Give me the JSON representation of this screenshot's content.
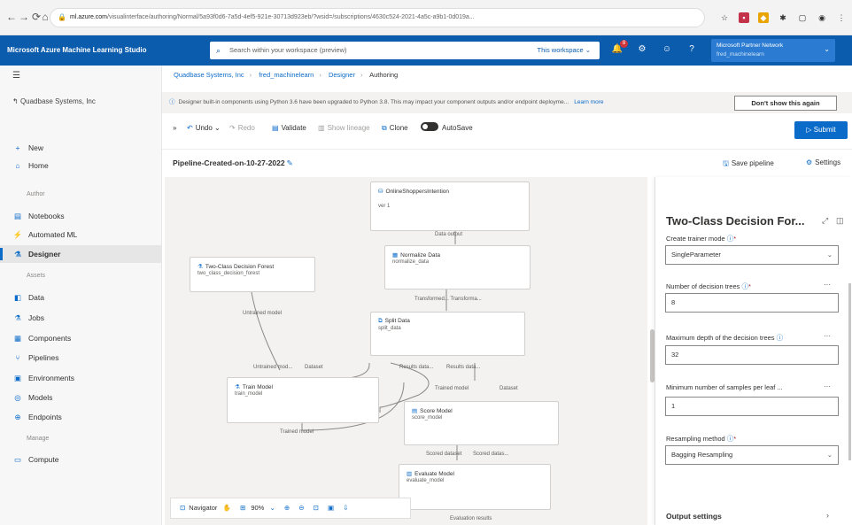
{
  "browser": {
    "address_host": "ml.azure.com",
    "address_rest": "/visualinterface/authoring/Normal/5a93f0d6-7a5d-4ef5-921e-30713d923eb/?wsid=/subscriptions/4630c524-2021-4a5c-a9b1-0d019a...",
    "icons": [
      "back-icon",
      "forward-icon",
      "refresh-icon",
      "home-icon",
      "lock-icon",
      "favorite-icon",
      "extensions-icon",
      "profile-icon"
    ]
  },
  "topbar": {
    "app_name": "Microsoft Azure Machine Learning Studio",
    "search_placeholder": "Search within your workspace (preview)",
    "search_scope": "This workspace ⌄",
    "notification_count": "8",
    "account_name": "Microsoft Partner Network",
    "account_sub": "fred_machinelearn"
  },
  "sidebar": {
    "workspace": "Quadbase Systems, Inc",
    "items": [
      {
        "label": "New",
        "icon": "+"
      },
      {
        "label": "Home",
        "icon": "⌂"
      },
      {
        "label": "Notebooks",
        "icon": "▤"
      },
      {
        "label": "Automated ML",
        "icon": "⚡"
      },
      {
        "label": "Designer",
        "icon": "⚗"
      },
      {
        "label": "Data",
        "icon": "◧"
      },
      {
        "label": "Jobs",
        "icon": "⚗"
      },
      {
        "label": "Components",
        "icon": "▦"
      },
      {
        "label": "Pipelines",
        "icon": "⑂"
      },
      {
        "label": "Environments",
        "icon": "▣"
      },
      {
        "label": "Models",
        "icon": "◎"
      },
      {
        "label": "Endpoints",
        "icon": "⊕"
      },
      {
        "label": "Compute",
        "icon": "▭"
      }
    ],
    "sections": [
      "Author",
      "Assets",
      "Manage"
    ]
  },
  "breadcrumb": [
    "Quadbase Systems, Inc",
    "fred_machinelearn",
    "Designer",
    "Authoring"
  ],
  "infobar": {
    "text": "Designer built-in components using Python 3.6 have been upgraded to Python 3.8. This may impact your component outputs and/or endpoint deployme...",
    "learn_more": "Learn more",
    "dismiss": "Don't show this again"
  },
  "toolbar": {
    "undo": "Undo",
    "redo": "Redo",
    "validate": "Validate",
    "show_lineage": "Show lineage",
    "clone": "Clone",
    "autosave": "AutoSave",
    "submit": "Submit"
  },
  "pipeline": {
    "name": "Pipeline-Created-on-10-27-2022",
    "save": "Save pipeline",
    "settings": "Settings"
  },
  "canvas": {
    "nodes": [
      {
        "title": "OnlineShoppersIntention",
        "sub": "ver 1"
      },
      {
        "title": "Normalize Data",
        "sub": "normalize_data"
      },
      {
        "title": "Two-Class Decision Forest",
        "sub": "two_class_decision_forest"
      },
      {
        "title": "Split Data",
        "sub": "split_data"
      },
      {
        "title": "Train Model",
        "sub": "train_model"
      },
      {
        "title": "Score Model",
        "sub": "score_model"
      },
      {
        "title": "Evaluate Model",
        "sub": "evaluate_model"
      }
    ],
    "ports": {
      "dataset": "Data output",
      "transformed": "Transformed... Transforma...",
      "untrained": "Untrained model",
      "untrained2": "Untrained mod...",
      "dataset2": "Dataset",
      "results1": "Results data...",
      "results2": "Results data...",
      "trained": "Trained model",
      "trained2": "Trained model",
      "dataset3": "Dataset",
      "scored": "Scored dataset",
      "scored2": "Scored datas...",
      "evaluation": "Evaluation results"
    },
    "navigator": {
      "label": "Navigator",
      "zoom": "90%"
    }
  },
  "panel": {
    "title": "Two-Class Decision For...",
    "fields": [
      {
        "label": "Create trainer mode",
        "value": "SingleParameter",
        "dropdown": true
      },
      {
        "label": "Number of decision trees",
        "value": "8",
        "dropdown": false
      },
      {
        "label": "Maximum depth of the decision trees",
        "value": "32",
        "dropdown": false
      },
      {
        "label": "Minimum number of samples per leaf ...",
        "value": "1",
        "dropdown": false
      },
      {
        "label": "Resampling method",
        "value": "Bagging Resampling",
        "dropdown": true
      }
    ],
    "output_settings": "Output settings"
  }
}
